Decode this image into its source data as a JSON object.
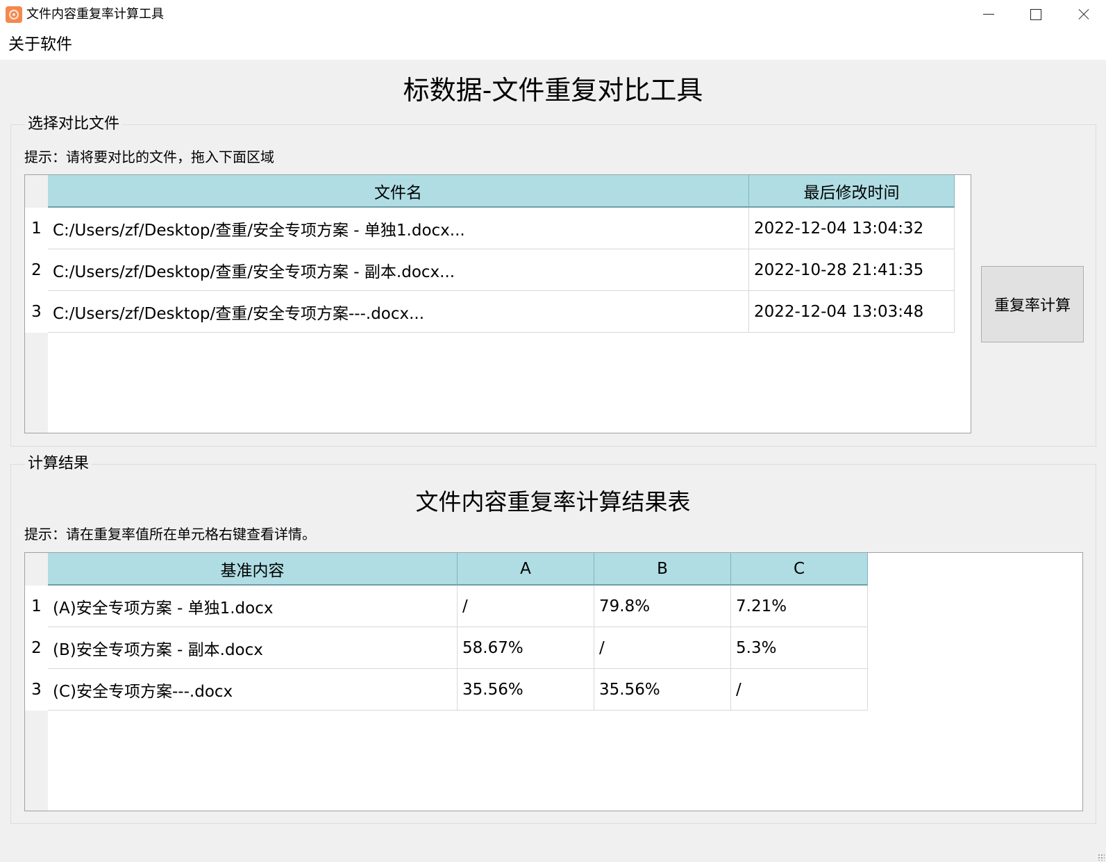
{
  "window": {
    "title": "文件内容重复率计算工具",
    "icon": "app-logo-icon"
  },
  "menu": {
    "items": [
      {
        "label": "关于软件"
      }
    ]
  },
  "main_title": "标数据-文件重复对比工具",
  "file_section": {
    "title": "选择对比文件",
    "hint": "提示：请将要对比的文件，拖入下面区域",
    "columns": [
      "文件名",
      "最后修改时间"
    ],
    "rows": [
      {
        "num": "1",
        "name": "C:/Users/zf/Desktop/查重/安全专项方案 - 单独1.docx...",
        "modified": "2022-12-04 13:04:32"
      },
      {
        "num": "2",
        "name": "C:/Users/zf/Desktop/查重/安全专项方案 - 副本.docx...",
        "modified": "2022-10-28 21:41:35"
      },
      {
        "num": "3",
        "name": "C:/Users/zf/Desktop/查重/安全专项方案---.docx...",
        "modified": "2022-12-04 13:03:48"
      }
    ],
    "calc_button": "重复率计算"
  },
  "result_section": {
    "title": "计算结果",
    "table_title": "文件内容重复率计算结果表",
    "hint": "提示：请在重复率值所在单元格右键查看详情。",
    "columns": [
      "基准内容",
      "A",
      "B",
      "C"
    ],
    "rows": [
      {
        "num": "1",
        "base": "(A)安全专项方案 - 单独1.docx",
        "a": "/",
        "b": "79.8%",
        "c": "7.21%"
      },
      {
        "num": "2",
        "base": "(B)安全专项方案 - 副本.docx",
        "a": "58.67%",
        "b": "/",
        "c": "5.3%"
      },
      {
        "num": "3",
        "base": "(C)安全专项方案---.docx",
        "a": "35.56%",
        "b": "35.56%",
        "c": "/"
      }
    ]
  },
  "colors": {
    "header_bg": "#b0dde4",
    "window_bg": "#f0f0f0",
    "app_icon": "#f3894e"
  }
}
